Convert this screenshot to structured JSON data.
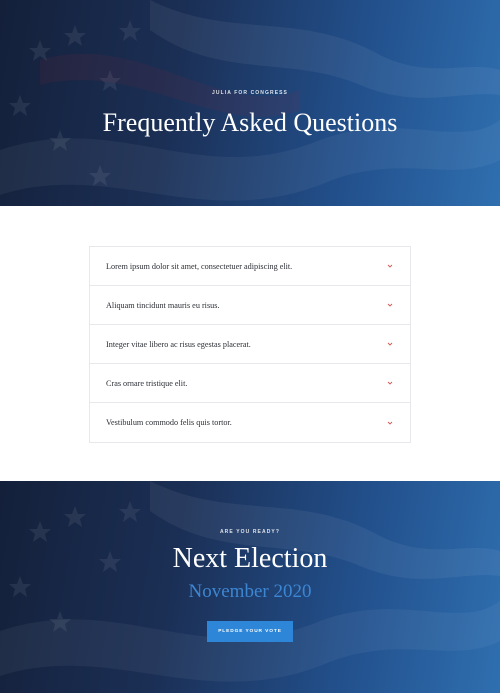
{
  "hero": {
    "eyebrow": "JULIA FOR CONGRESS",
    "title": "Frequently Asked Questions"
  },
  "faq": {
    "items": [
      {
        "question": "Lorem ipsum dolor sit amet, consectetuer adipiscing elit."
      },
      {
        "question": "Aliquam tincidunt mauris eu risus."
      },
      {
        "question": "Integer vitae libero ac risus egestas placerat."
      },
      {
        "question": "Cras ornare tristique elit."
      },
      {
        "question": "Vestibulum commodo felis quis tortor."
      }
    ],
    "chevron_icon": "chevron-down-icon",
    "chevron_color": "#d9534f"
  },
  "cta": {
    "eyebrow": "ARE YOU READY?",
    "title": "Next Election",
    "subtitle": "November 2020",
    "button_label": "PLEDGE YOUR VOTE"
  },
  "colors": {
    "hero_dark": "#14203a",
    "hero_blue": "#2f6fb0",
    "accent_blue": "#2d86d8",
    "subtitle_blue": "#3d86d2"
  }
}
